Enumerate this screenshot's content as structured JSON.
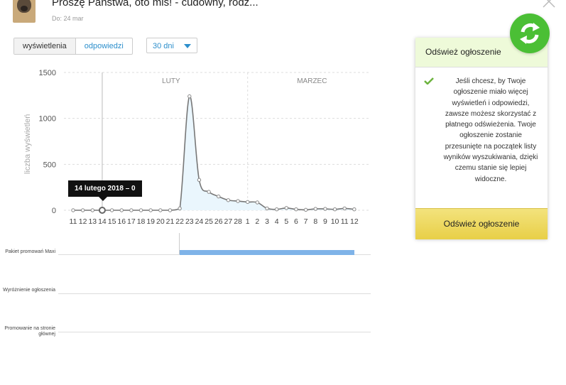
{
  "header": {
    "title": "Proszę Państwa, oto miś! - cudowny, rodz...",
    "subtitle": "Do: 24 mar"
  },
  "tabs": [
    {
      "label": "wyświetlenia",
      "active": true
    },
    {
      "label": "odpowiedzi",
      "active": false
    }
  ],
  "period_select": {
    "value": "30 dni"
  },
  "tooltip": {
    "text": "14 lutego 2018 – 0"
  },
  "promotions": [
    {
      "label": "Pakiet promowań Maxi"
    },
    {
      "label": "Wyróżnienie ogłoszenia"
    },
    {
      "label": "Promowanie na stronie głównej"
    }
  ],
  "panel": {
    "title": "Odśwież ogłoszenie",
    "text": "Jeśli chcesz, by Twoje ogłoszenie miało więcej wyświetleń i odpowiedzi, zawsze możesz skorzystać z płatnego odświeżenia. Twoje ogłoszenie zostanie przesunięte na początek listy wyników wyszukiwania, dzięki czemu stanie się lepiej widoczne.",
    "button_label": "Odśwież ogłoszenie"
  },
  "colors": {
    "accent_blue": "#2d8fcc",
    "line": "#777777",
    "area_fill": "#eaf6fd",
    "promo_bar": "#7fb3e8",
    "panel_head": "#eefad9",
    "button_yellow": "#ecd658",
    "refresh_green": "#4bbf35"
  },
  "chart_data": {
    "type": "line",
    "ylabel": "liczba wyświetleń",
    "ylim": [
      0,
      1500
    ],
    "yticks": [
      0,
      500,
      1000,
      1500
    ],
    "month_labels": [
      "LUTY",
      "MARZEC"
    ],
    "categories": [
      "11",
      "12",
      "13",
      "14",
      "15",
      "16",
      "17",
      "18",
      "19",
      "20",
      "21",
      "22",
      "23",
      "24",
      "25",
      "26",
      "27",
      "28",
      "1",
      "2",
      "3",
      "4",
      "5",
      "6",
      "7",
      "8",
      "9",
      "10",
      "11",
      "12"
    ],
    "values": [
      0,
      0,
      0,
      0,
      0,
      0,
      0,
      0,
      0,
      0,
      0,
      20,
      1240,
      330,
      200,
      150,
      110,
      100,
      90,
      85,
      20,
      10,
      25,
      10,
      5,
      15,
      15,
      10,
      20,
      10
    ],
    "highlight_index": 3,
    "grid": true,
    "promo_bar": {
      "series": "Pakiet promowań Maxi",
      "start_index": 11,
      "end_index": 29
    }
  }
}
